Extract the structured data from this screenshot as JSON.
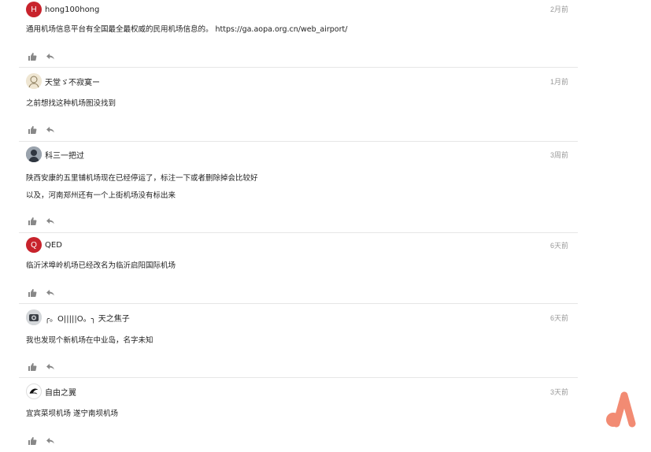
{
  "comments": [
    {
      "name": "hong100hong",
      "avatar_letter": "H",
      "avatar_kind": "letter",
      "time": "2月前",
      "lines": [
        "通用机场信息平台有全国最全最权威的民用机场信息的。 https://ga.aopa.org.cn/web_airport/"
      ]
    },
    {
      "name": "天堂ゞ不寂寞ー",
      "avatar_kind": "image-sketch",
      "time": "1月前",
      "lines": [
        "之前想找这种机场图没找到"
      ]
    },
    {
      "name": "科三一把过",
      "avatar_kind": "image-person",
      "time": "3周前",
      "lines": [
        "陕西安康的五里铺机场现在已经停运了，标注一下或者删除掉会比较好",
        "以及，河南郑州还有一个上街机场没有标出来"
      ]
    },
    {
      "name": "QED",
      "avatar_letter": "Q",
      "avatar_kind": "letter",
      "time": "6天前",
      "lines": [
        "临沂沭埠岭机场已经改名为临沂启阳国际机场"
      ]
    },
    {
      "name": "╭。O|||||O。╮ 天之焦子",
      "avatar_kind": "image-camera",
      "time": "6天前",
      "lines": [
        "我也发现个新机场在中业岛，名字未知"
      ]
    },
    {
      "name": "自由之翼",
      "avatar_kind": "image-swirl",
      "time": "3天前",
      "lines": [
        "宜宾菜坝机场 遂宁南坝机场"
      ]
    }
  ],
  "icons": {
    "like": "thumbs-up-icon",
    "reply": "reply-arrow-icon"
  },
  "colors": {
    "avatar_red": "#c8232c",
    "logo": "#f28b73",
    "meta": "#999999"
  }
}
